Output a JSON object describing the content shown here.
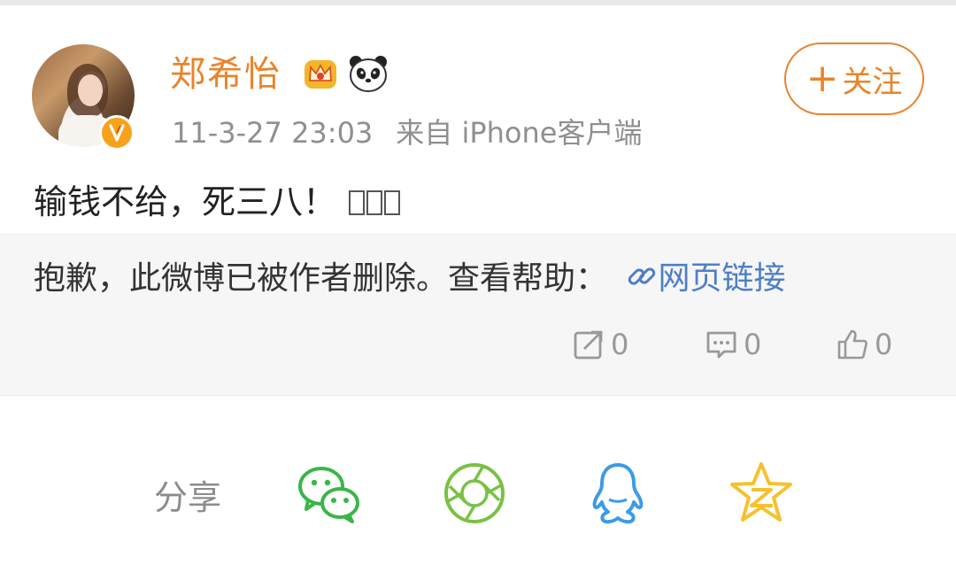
{
  "user": {
    "name": "郑希怡",
    "timestamp": "11-3-27 23:03",
    "source": "来自 iPhone客户端"
  },
  "follow_button": {
    "plus": "+",
    "label": "关注"
  },
  "post": {
    "text": "输钱不给，死三八！"
  },
  "deleted_notice": {
    "message": "抱歉，此微博已被作者删除。查看帮助：",
    "link_label": "网页链接"
  },
  "actions": {
    "repost_count": "0",
    "comment_count": "0",
    "like_count": "0"
  },
  "share": {
    "label": "分享",
    "targets": [
      "wechat-icon",
      "moments-icon",
      "qq-icon",
      "qzone-icon"
    ]
  },
  "colors": {
    "accent_orange": "#e8842a",
    "link_blue": "#4f7ec4",
    "wechat_green": "#3bb54a",
    "qq_blue": "#3c9be6",
    "qzone_yellow": "#f5c12e"
  }
}
